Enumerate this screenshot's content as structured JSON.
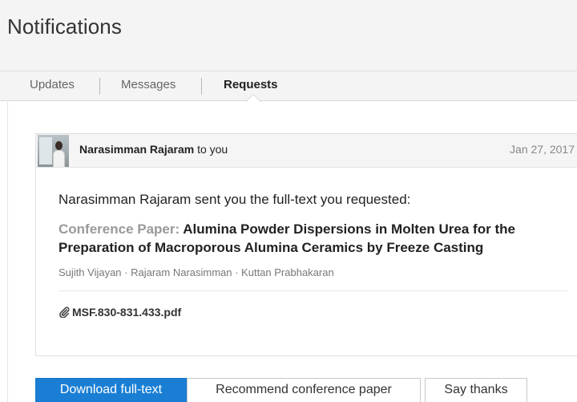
{
  "header": {
    "title": "Notifications"
  },
  "tabs": [
    {
      "label": "Updates",
      "active": false
    },
    {
      "label": "Messages",
      "active": false
    },
    {
      "label": "Requests",
      "active": true
    }
  ],
  "notification": {
    "sender": "Narasimman Rajaram",
    "recipient_text": "to you",
    "date": "Jan 27, 2017",
    "message": "Narasimman Rajaram sent you the full-text you requested:",
    "paper_type": "Conference Paper:",
    "paper_title": "Alumina Powder Dispersions in Molten Urea for the Preparation of Macroporous Alumina Ceramics by Freeze Casting",
    "authors": "Sujith Vijayan · Rajaram Narasimman · Kuttan Prabhakaran",
    "attachment": "MSF.830-831.433.pdf",
    "attachment_icon": "paperclip-icon"
  },
  "actions": {
    "download_label": "Download full-text",
    "recommend_label": "Recommend conference paper",
    "thanks_label": "Say thanks"
  },
  "colors": {
    "primary_button": "#1a7fd4",
    "header_bg": "#f4f4f4",
    "paper_type": "#999999"
  }
}
